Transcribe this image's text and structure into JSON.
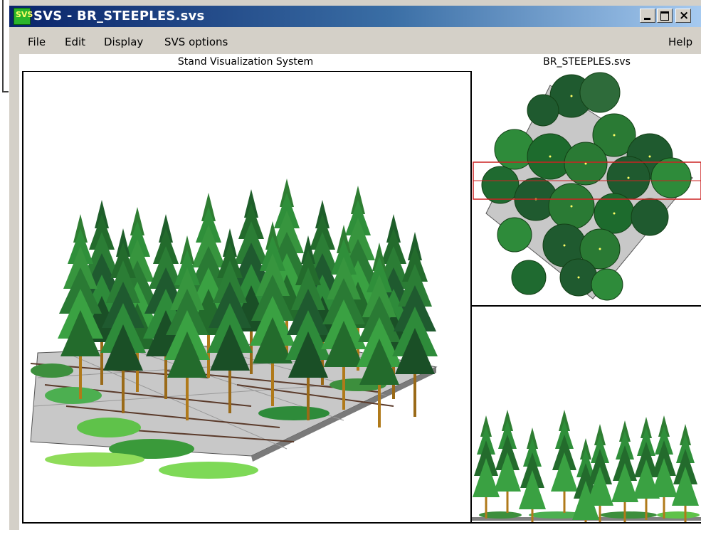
{
  "window": {
    "title": "SVS - BR_STEEPLES.svs",
    "icon_label": "SVS",
    "buttons": {
      "minimize": "minimize-icon",
      "maximize": "maximize-icon",
      "close": "×"
    }
  },
  "menu": {
    "file": "File",
    "edit": "Edit",
    "display": "Display",
    "svs_options": "SVS options",
    "help": "Help"
  },
  "header": {
    "left": "Stand Visualization System",
    "right": "BR_STEEPLES.svs"
  },
  "colors": {
    "title_start": "#0a246a",
    "title_end": "#a6caf0",
    "foliage_dark": "#1f5a2f",
    "foliage_mid": "#2e8b3a",
    "foliage_light": "#5fc24a",
    "trunk": "#b07a1a",
    "ground": "#c8c8c8",
    "selection": "#cc2222"
  }
}
